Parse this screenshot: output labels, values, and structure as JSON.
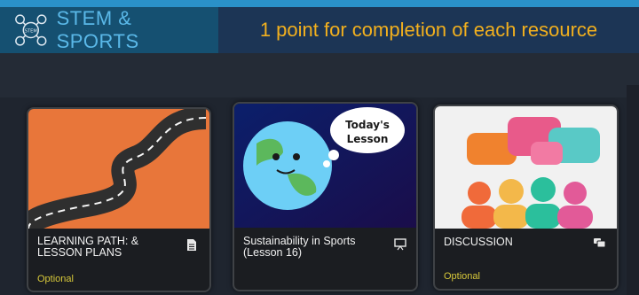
{
  "header": {
    "brand": "STEM & SPORTS",
    "logo_text": "STEM",
    "headline": "1 point for completion of each resource"
  },
  "cards": [
    {
      "title_line1": "LEARNING PATH: &",
      "title_line2": "LESSON PLANS",
      "content_icon": "document-icon",
      "badge": "Optional"
    },
    {
      "title_line1": "Sustainability in Sports",
      "title_line2": "(Lesson 16)",
      "content_icon": "presentation-icon",
      "image_text_line1": "Today's",
      "image_text_line2": "Lesson"
    },
    {
      "title_line1": "DISCUSSION",
      "content_icon": "chat-icon",
      "badge": "Optional"
    }
  ],
  "colors": {
    "brand": "#5ab8e8",
    "headline": "#f2b01e",
    "optional": "#d7c83a"
  }
}
